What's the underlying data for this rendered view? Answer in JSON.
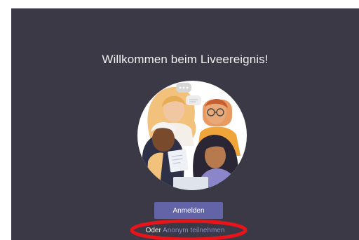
{
  "page": {
    "title": "Willkommen beim Liveereignis!"
  },
  "actions": {
    "signin_label": "Anmelden",
    "or_label": "Oder",
    "anonymous_label": "Anonym teilnehmen"
  },
  "colors": {
    "window_background": "#3a3945",
    "accent": "#6264a7",
    "link": "#8b8cc7",
    "highlight_annotation": "#e8141a"
  },
  "icons": {
    "hero": "people-group-illustration",
    "annotation": "red-highlight-ellipse"
  }
}
